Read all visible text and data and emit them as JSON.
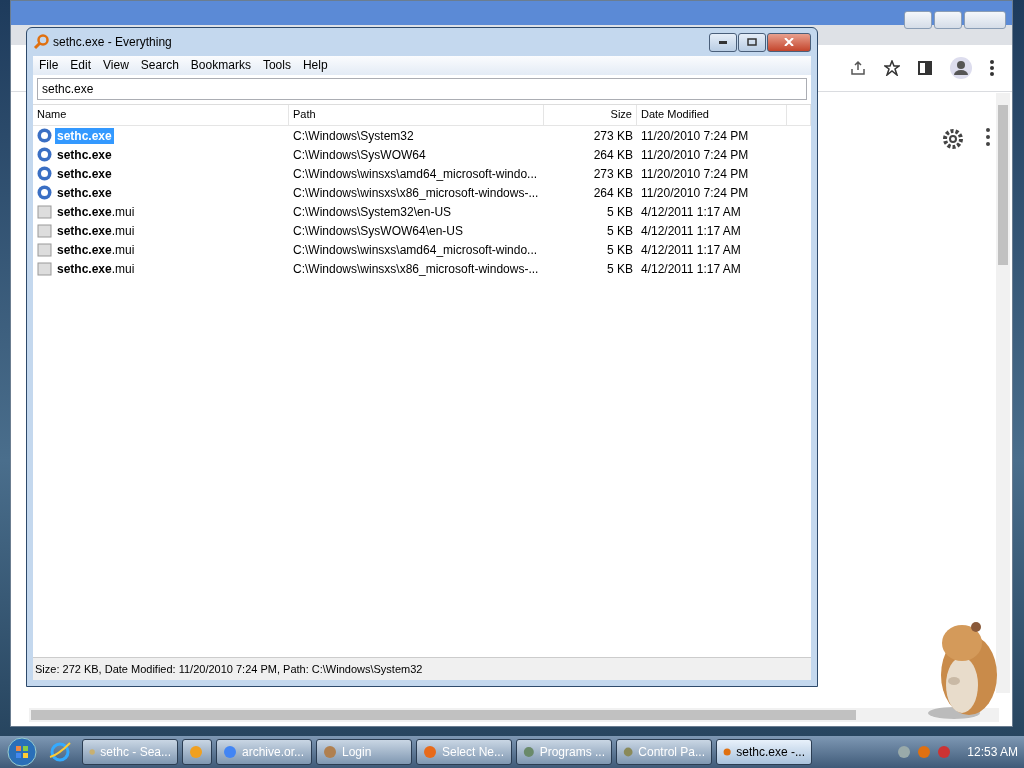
{
  "app_window": {
    "title": "sethc.exe - Everything",
    "menu": [
      "File",
      "Edit",
      "View",
      "Search",
      "Bookmarks",
      "Tools",
      "Help"
    ],
    "search": {
      "value": "sethc.exe"
    },
    "columns": [
      "Name",
      "Path",
      "Size",
      "Date Modified"
    ],
    "rows": [
      {
        "kind": "exe",
        "name": "sethc.exe",
        "path": "C:\\Windows\\System32",
        "size": "273 KB",
        "date": "11/20/2010 7:24 PM",
        "selected": true
      },
      {
        "kind": "exe",
        "name": "sethc.exe",
        "path": "C:\\Windows\\SysWOW64",
        "size": "264 KB",
        "date": "11/20/2010 7:24 PM",
        "selected": false
      },
      {
        "kind": "exe",
        "name": "sethc.exe",
        "path": "C:\\Windows\\winsxs\\amd64_microsoft-windo...",
        "size": "273 KB",
        "date": "11/20/2010 7:24 PM",
        "selected": false
      },
      {
        "kind": "exe",
        "name": "sethc.exe",
        "path": "C:\\Windows\\winsxs\\x86_microsoft-windows-...",
        "size": "264 KB",
        "date": "11/20/2010 7:24 PM",
        "selected": false
      },
      {
        "kind": "mui",
        "name": "**sethc.exe**.mui",
        "path": "C:\\Windows\\System32\\en-US",
        "size": "5 KB",
        "date": "4/12/2011 1:17 AM",
        "selected": false
      },
      {
        "kind": "mui",
        "name": "**sethc.exe**.mui",
        "path": "C:\\Windows\\SysWOW64\\en-US",
        "size": "5 KB",
        "date": "4/12/2011 1:17 AM",
        "selected": false
      },
      {
        "kind": "mui",
        "name": "**sethc.exe**.mui",
        "path": "C:\\Windows\\winsxs\\amd64_microsoft-windo...",
        "size": "5 KB",
        "date": "4/12/2011 1:17 AM",
        "selected": false
      },
      {
        "kind": "mui",
        "name": "**sethc.exe**.mui",
        "path": "C:\\Windows\\winsxs\\x86_microsoft-windows-...",
        "size": "5 KB",
        "date": "4/12/2011 1:17 AM",
        "selected": false
      }
    ],
    "status_bar": "Size: 272 KB, Date Modified: 11/20/2010 7:24 PM, Path: C:\\Windows\\System32"
  },
  "taskbar": {
    "items": [
      {
        "label": "sethc - Sea...",
        "selected": false
      },
      {
        "kind": "icon",
        "selected": false
      },
      {
        "label": "archive.or...",
        "selected": false
      },
      {
        "label": "Login",
        "selected": false
      },
      {
        "label": "Select Ne...",
        "selected": false
      },
      {
        "label": "Programs ...",
        "selected": false
      },
      {
        "label": "Control Pa...",
        "selected": false
      },
      {
        "label": "sethc.exe -...",
        "selected": true
      }
    ],
    "clock": "12:53 AM"
  }
}
